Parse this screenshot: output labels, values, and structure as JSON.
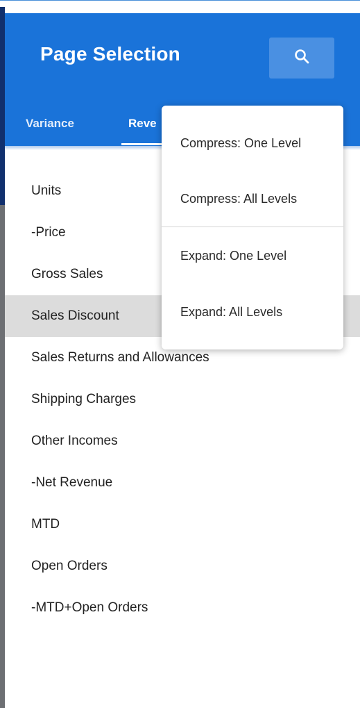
{
  "header": {
    "title": "Page Selection",
    "search_icon": "search-icon",
    "accent_color": "#1a73d9"
  },
  "tabs": [
    {
      "label": "Variance"
    },
    {
      "label": "Reve"
    }
  ],
  "list": {
    "selected_index": 3,
    "items": [
      {
        "label": "Units"
      },
      {
        "label": "-Price"
      },
      {
        "label": "Gross Sales"
      },
      {
        "label": "Sales Discount"
      },
      {
        "label": "Sales Returns and Allowances"
      },
      {
        "label": "Shipping Charges"
      },
      {
        "label": "Other Incomes"
      },
      {
        "label": "-Net Revenue"
      },
      {
        "label": "MTD"
      },
      {
        "label": "Open Orders"
      },
      {
        "label": "-MTD+Open Orders"
      }
    ]
  },
  "context_menu": {
    "items": [
      {
        "label": "Compress: One Level"
      },
      {
        "label": "Compress: All Levels"
      },
      {
        "label": "Expand: One Level"
      },
      {
        "label": "Expand: All Levels"
      }
    ]
  }
}
